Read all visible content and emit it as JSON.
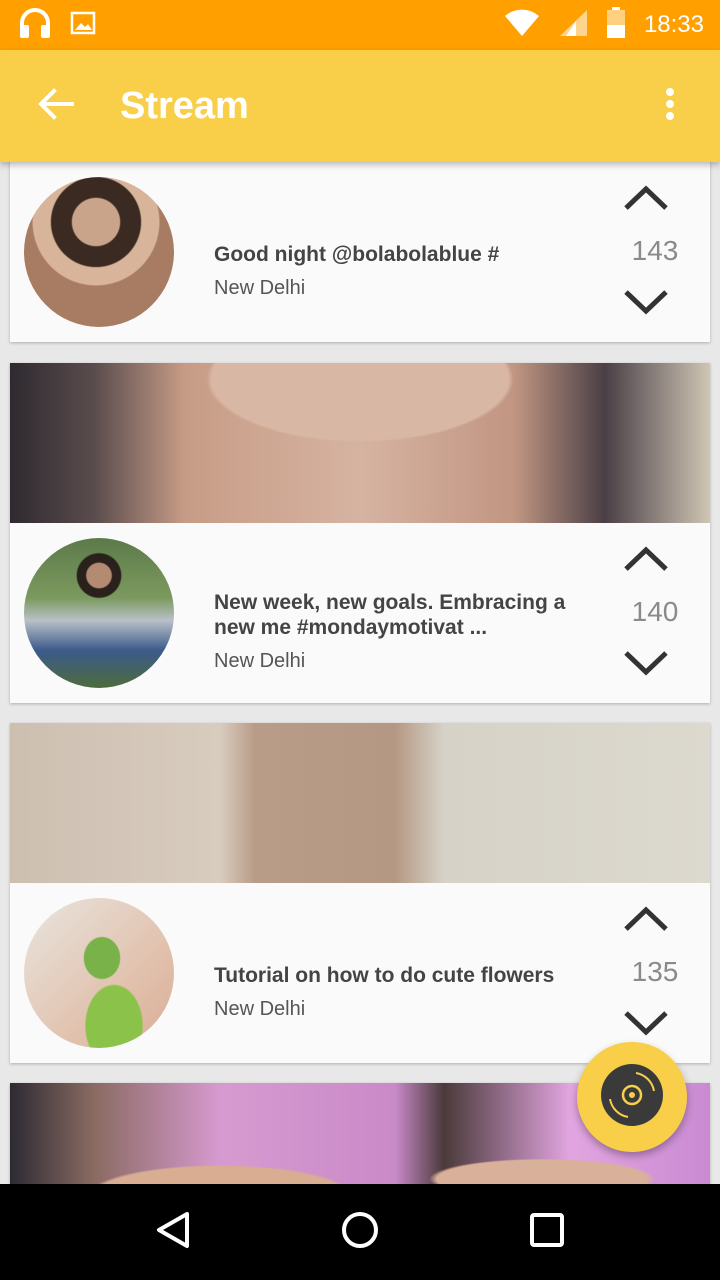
{
  "status_bar": {
    "time": "18:33",
    "icons": [
      "headphones-icon",
      "image-icon",
      "wifi-icon",
      "signal-icon",
      "battery-icon"
    ]
  },
  "app_bar": {
    "title": "Stream",
    "back_icon": "arrow-back-icon",
    "menu_icon": "more-vert-icon",
    "color": "#F9CF4A"
  },
  "posts": [
    {
      "title": "Good night  @bolabolablue #",
      "location": "New Delhi",
      "votes": "143"
    },
    {
      "title": "New week, new goals. Embracing a new me  #mondaymotivat ...",
      "location": "New Delhi",
      "votes": "140"
    },
    {
      "title": "Tutorial on how to do cute flowers",
      "location": "New Delhi",
      "votes": "135"
    }
  ],
  "fab": {
    "icon": "music-disc-icon"
  },
  "nav": {
    "icons": [
      "back-triangle-icon",
      "home-circle-icon",
      "recents-square-icon"
    ]
  },
  "colors": {
    "status_bar": "#FFA000",
    "accent": "#F9CF4A",
    "vote_count": "#8a8a8a"
  }
}
